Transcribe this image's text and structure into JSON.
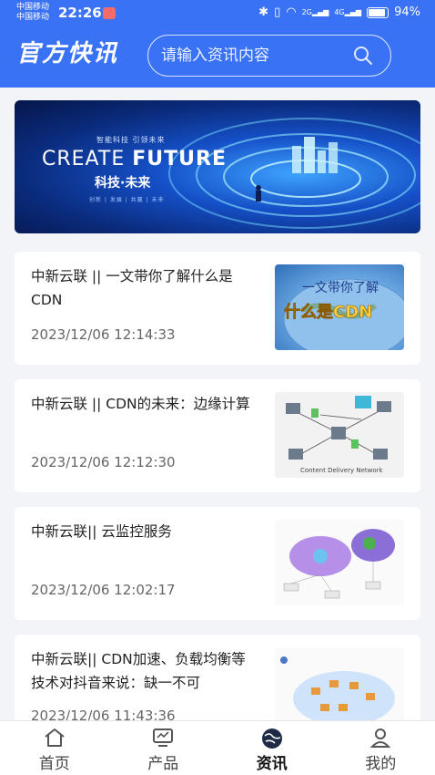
{
  "status_bar": {
    "carrier1": "中国移动",
    "carrier2": "中国移动",
    "time": "22:26",
    "battery": "94%",
    "signal_labels": [
      "2G",
      "4G"
    ]
  },
  "header": {
    "title": "官方快讯",
    "search_placeholder": "请输入资讯内容",
    "search_icon": "search-icon"
  },
  "banner": {
    "small_text": "智能科技 引领未来",
    "main_prefix": "CREATE ",
    "main_bold": "FUTURE",
    "subtitle": "科技·未来",
    "footer_text": "创新 | 发展 | 共赢 | 未来"
  },
  "news": [
    {
      "title": "中新云联 || 一文带你了解什么是CDN",
      "date": "2023/12/06 12:14:33",
      "thumb_text1": "一文带你了解",
      "thumb_text2": "什么是CDN"
    },
    {
      "title": "中新云联 || CDN的未来：边缘计算",
      "date": "2023/12/06 12:12:30",
      "thumb_caption": "Content Delivery Network"
    },
    {
      "title": "中新云联|| 云监控服务",
      "date": "2023/12/06 12:02:17"
    },
    {
      "title": "中新云联|| CDN加速、负载均衡等技术对抖音来说：缺一不可",
      "date": "2023/12/06 11:43:36"
    }
  ],
  "tabs": [
    {
      "label": "首页",
      "icon": "home-icon"
    },
    {
      "label": "产品",
      "icon": "monitor-icon"
    },
    {
      "label": "资讯",
      "icon": "globe-icon"
    },
    {
      "label": "我的",
      "icon": "user-icon"
    }
  ],
  "colors": {
    "primary": "#3a72f6",
    "background": "#f3f4f8"
  }
}
